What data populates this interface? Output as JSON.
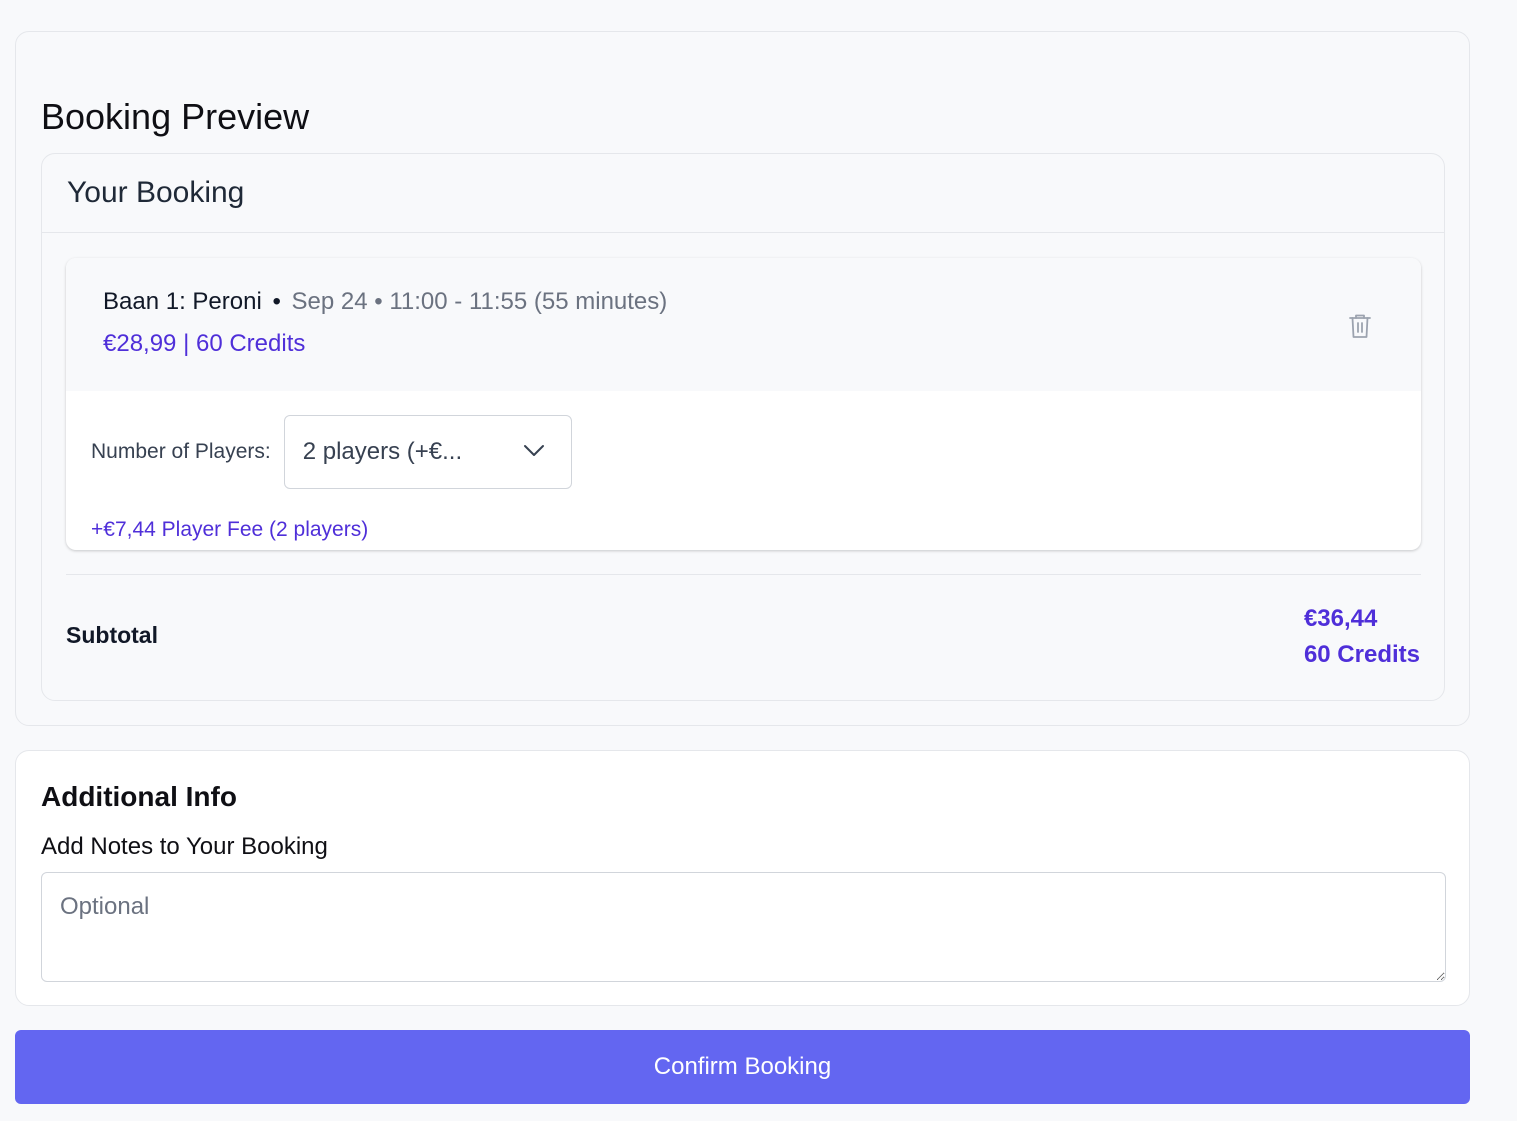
{
  "preview": {
    "title": "Booking Preview"
  },
  "your_booking": {
    "title": "Your Booking",
    "item": {
      "court": "Baan 1: Peroni",
      "separator": "•",
      "datetime": "Sep 24 • 11:00 - 11:55 (55 minutes)",
      "price": "€28,99 | 60 Credits",
      "delete_icon": "trash-icon"
    },
    "players": {
      "label": "Number of Players:",
      "selected": "2 players (+€...",
      "fee": "+€7,44 Player Fee (2 players)"
    },
    "subtotal": {
      "label": "Subtotal",
      "price": "€36,44",
      "credits": "60 Credits"
    }
  },
  "additional_info": {
    "title": "Additional Info",
    "notes_label": "Add Notes to Your Booking",
    "notes_placeholder": "Optional",
    "notes_value": ""
  },
  "confirm": {
    "label": "Confirm Booking"
  },
  "colors": {
    "accent": "#6366f1",
    "price": "#4f2fd9",
    "muted": "#6b7280"
  }
}
